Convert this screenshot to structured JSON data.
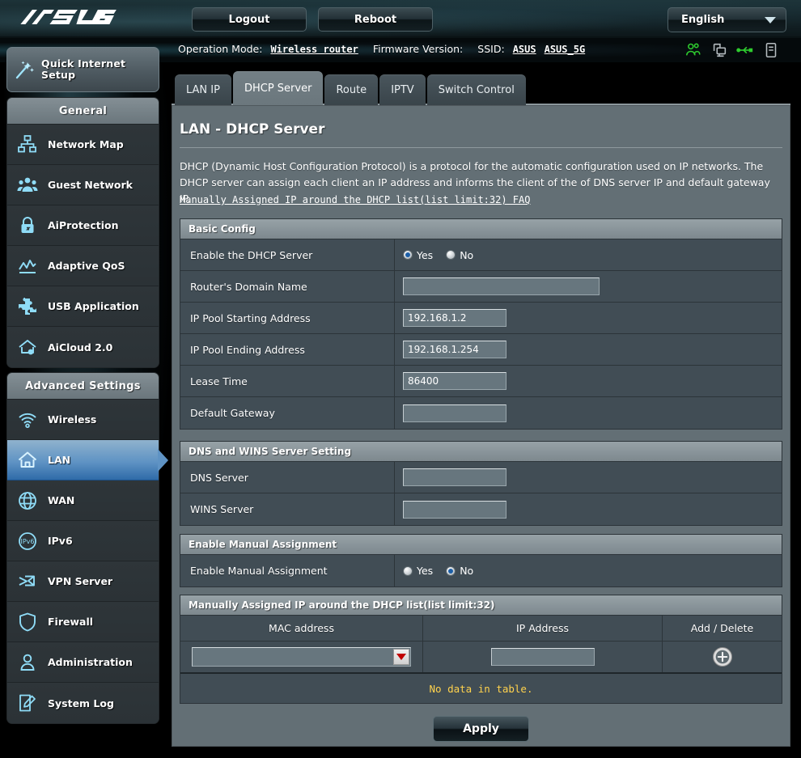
{
  "banner": {
    "logo": "/ISUS",
    "logout_label": "Logout",
    "reboot_label": "Reboot",
    "language": "English"
  },
  "infostrip": {
    "operation_mode_label": "Operation Mode:",
    "operation_mode_value": "Wireless router",
    "firmware_label": "Firmware Version:",
    "firmware_value": "",
    "ssid_label": "SSID:",
    "ssid_1": "ASUS",
    "ssid_2": "ASUS_5G",
    "icons": [
      {
        "name": "clients-icon",
        "color": "#2ecc2e"
      },
      {
        "name": "network-monitors-icon",
        "color": "#b6bdc1"
      },
      {
        "name": "usb-icon",
        "color": "#2ecc2e"
      },
      {
        "name": "printer-icon",
        "color": "#b6bdc1"
      }
    ]
  },
  "sidebar": {
    "quick_setup_label": "Quick Internet Setup",
    "groups": [
      {
        "title": "General",
        "items": [
          {
            "label": "Network Map",
            "icon": "network-map-icon",
            "active": false
          },
          {
            "label": "Guest Network",
            "icon": "guest-network-icon",
            "active": false
          },
          {
            "label": "AiProtection",
            "icon": "lock-icon",
            "active": false
          },
          {
            "label": "Adaptive QoS",
            "icon": "chart-icon",
            "active": false
          },
          {
            "label": "USB Application",
            "icon": "puzzle-icon",
            "active": false
          },
          {
            "label": "AiCloud 2.0",
            "icon": "cloud-icon",
            "active": false
          }
        ]
      },
      {
        "title": "Advanced Settings",
        "items": [
          {
            "label": "Wireless",
            "icon": "wifi-icon",
            "active": false
          },
          {
            "label": "LAN",
            "icon": "home-icon",
            "active": true
          },
          {
            "label": "WAN",
            "icon": "globe-icon",
            "active": false
          },
          {
            "label": "IPv6",
            "icon": "ipv6-globe-icon",
            "active": false
          },
          {
            "label": "VPN Server",
            "icon": "vpn-icon",
            "active": false
          },
          {
            "label": "Firewall",
            "icon": "shield-icon",
            "active": false
          },
          {
            "label": "Administration",
            "icon": "user-icon",
            "active": false
          },
          {
            "label": "System Log",
            "icon": "log-icon",
            "active": false
          }
        ]
      }
    ]
  },
  "tabs": [
    {
      "label": "LAN IP",
      "active": false
    },
    {
      "label": "DHCP Server",
      "active": true
    },
    {
      "label": "Route",
      "active": false
    },
    {
      "label": "IPTV",
      "active": false
    },
    {
      "label": "Switch Control",
      "active": false
    }
  ],
  "page": {
    "title": "LAN - DHCP Server",
    "description": "DHCP (Dynamic Host Configuration Protocol) is a protocol for the automatic configuration used on IP networks. The DHCP server can assign each client an IP address and informs the client of the of DNS server IP and default gateway IP.",
    "faq_link": "Manually Assigned IP around the DHCP list(list limit:32) FAQ"
  },
  "basic_config": {
    "section_title": "Basic Config",
    "enable_dhcp": {
      "label": "Enable the DHCP Server",
      "yes_label": "Yes",
      "no_label": "No",
      "selected": "Yes"
    },
    "domain_name": {
      "label": "Router's Domain Name",
      "value": "",
      "placeholder": ""
    },
    "pool_start": {
      "label": "IP Pool Starting Address",
      "value": "192.168.1.2",
      "placeholder": ""
    },
    "pool_end": {
      "label": "IP Pool Ending Address",
      "value": "192.168.1.254",
      "placeholder": ""
    },
    "lease_time": {
      "label": "Lease Time",
      "value": "86400",
      "placeholder": ""
    },
    "default_gateway": {
      "label": "Default Gateway",
      "value": "",
      "placeholder": ""
    }
  },
  "dns_wins": {
    "section_title": "DNS and WINS Server Setting",
    "dns_server": {
      "label": "DNS Server",
      "value": "",
      "placeholder": ""
    },
    "wins_server": {
      "label": "WINS Server",
      "value": "",
      "placeholder": ""
    }
  },
  "manual_assignment": {
    "section_title": "Enable Manual Assignment",
    "enable": {
      "label": "Enable Manual Assignment",
      "yes_label": "Yes",
      "no_label": "No",
      "selected": "No"
    }
  },
  "assigned_table": {
    "section_title": "Manually Assigned IP around the DHCP list(list limit:32)",
    "columns": [
      "MAC address",
      "IP Address",
      "Add / Delete"
    ],
    "new_row": {
      "mac_value": "",
      "ip_value": "",
      "ip_placeholder": ""
    },
    "empty_message": "No data in table.",
    "rows": []
  },
  "footer": {
    "apply_label": "Apply"
  },
  "colors": {
    "panel_bg": "#636f75",
    "row_bg": "#414d55",
    "section_header": "#97a2a7",
    "accent_active": "#5f93c4",
    "warning_text": "#ffd24d",
    "icon_green": "#2ecc2e",
    "icon_cyan": "#7fd9f5"
  }
}
